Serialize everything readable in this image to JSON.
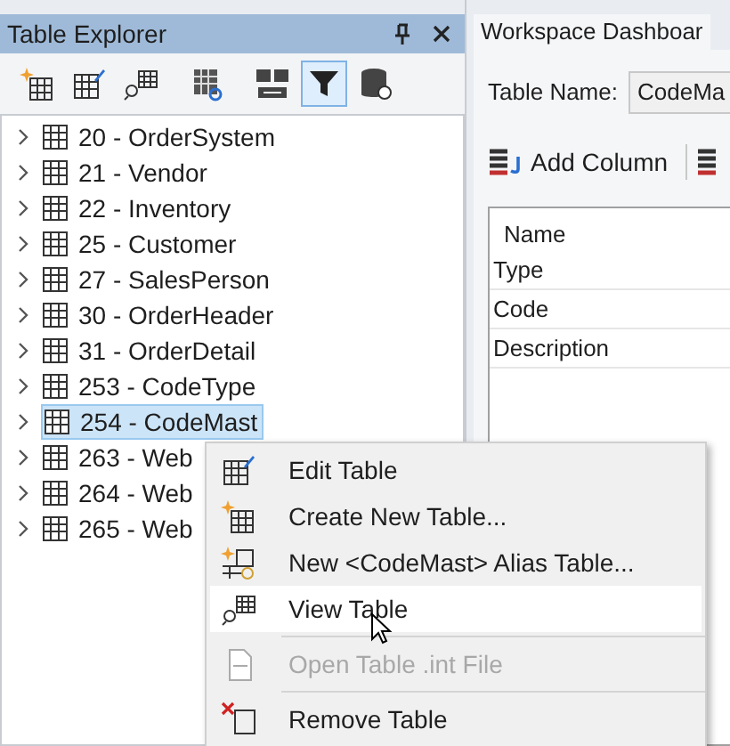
{
  "explorer": {
    "title": "Table Explorer",
    "toolbar": [
      {
        "selected": false
      },
      {
        "selected": false
      },
      {
        "selected": false
      },
      {
        "selected": false
      },
      {
        "selected": false
      },
      {
        "selected": true
      },
      {
        "selected": false
      }
    ],
    "tables": [
      {
        "label": "20 - OrderSystem",
        "selected": false
      },
      {
        "label": "21 - Vendor",
        "selected": false
      },
      {
        "label": "22 - Inventory",
        "selected": false
      },
      {
        "label": "25 - Customer",
        "selected": false
      },
      {
        "label": "27 - SalesPerson",
        "selected": false
      },
      {
        "label": "30 - OrderHeader",
        "selected": false
      },
      {
        "label": "31 - OrderDetail",
        "selected": false
      },
      {
        "label": "253 - CodeType",
        "selected": false
      },
      {
        "label": "254 - CodeMast",
        "selected": true
      },
      {
        "label": "263 - Web",
        "selected": false
      },
      {
        "label": "264 - Web",
        "selected": false
      },
      {
        "label": "265 - Web",
        "selected": false
      }
    ]
  },
  "workspace": {
    "tab": "Workspace Dashboar",
    "table_name_label": "Table Name:",
    "table_name": "CodeMa",
    "add_column": "Add Column",
    "grid_header": "Name",
    "grid_rows": [
      "Type",
      "Code",
      "Description"
    ]
  },
  "context_menu": [
    {
      "label": "Edit Table",
      "disabled": false,
      "highlighted": false
    },
    {
      "label": "Create New Table...",
      "disabled": false,
      "highlighted": false
    },
    {
      "label": "New <CodeMast> Alias Table...",
      "disabled": false,
      "highlighted": false
    },
    {
      "label": "View Table",
      "disabled": false,
      "highlighted": true
    },
    {
      "label": "Open Table .int File",
      "disabled": true,
      "highlighted": false
    },
    {
      "label": "Remove Table",
      "disabled": false,
      "highlighted": false
    }
  ]
}
